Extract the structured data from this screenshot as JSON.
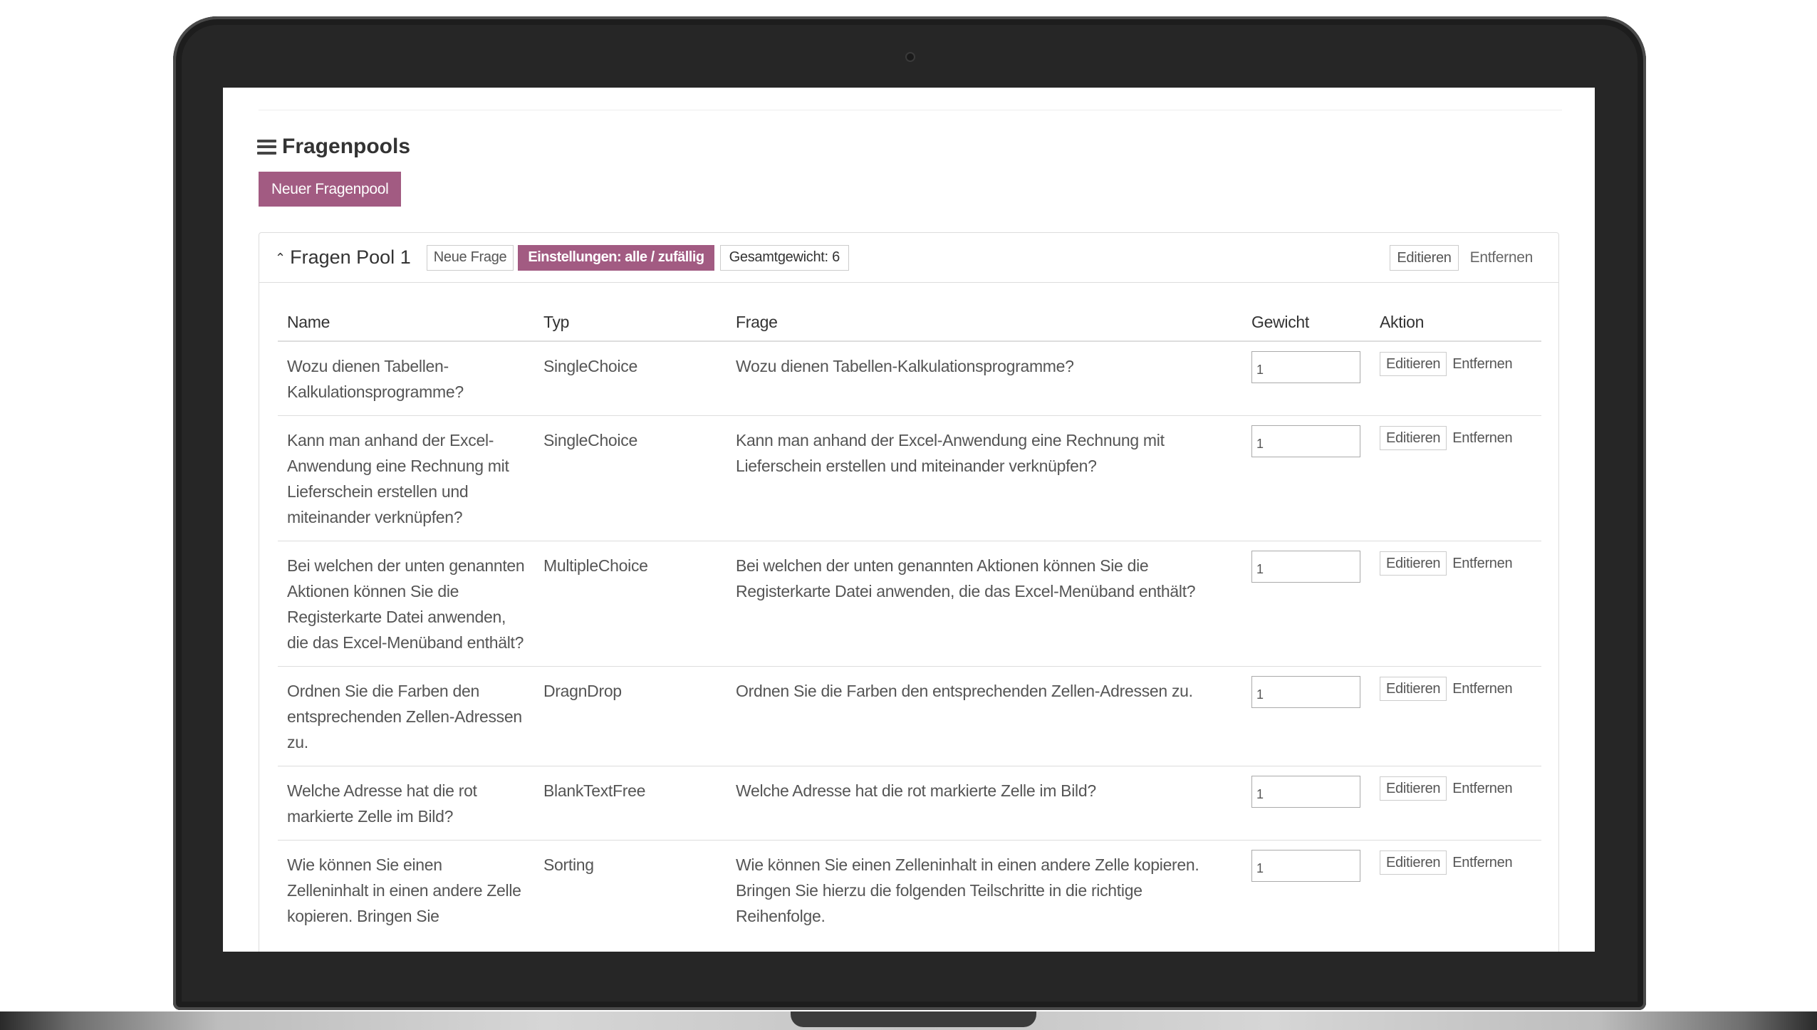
{
  "page": {
    "title": "Fragenpools",
    "new_pool_label": "Neuer Fragenpool"
  },
  "pool": {
    "title": "Fragen Pool",
    "number": "1",
    "new_question_label": "Neue Frage",
    "settings_label": "Einstellungen: alle  /  zufällig",
    "total_weight_label": "Gesamtgewicht: 6",
    "edit_label": "Editieren",
    "remove_label": "Entfernen"
  },
  "table": {
    "headers": {
      "name": "Name",
      "type": "Typ",
      "question": "Frage",
      "weight": "Gewicht",
      "action": "Aktion"
    },
    "rows": [
      {
        "name": "Wozu dienen Tabellen-Kalkulationsprogramme?",
        "type": "SingleChoice",
        "question": "Wozu dienen Tabellen-Kalkulationsprogramme?",
        "weight": "1",
        "edit": "Editieren",
        "remove": "Entfernen"
      },
      {
        "name": "Kann man anhand der Excel-Anwendung eine Rechnung mit Lieferschein erstellen und miteinander verknüpfen?",
        "type": "SingleChoice",
        "question": "Kann man anhand der Excel-Anwendung eine Rechnung mit Lieferschein erstellen und miteinander verknüpfen?",
        "weight": "1",
        "edit": "Editieren",
        "remove": "Entfernen"
      },
      {
        "name": "Bei welchen der unten genannten Aktionen können Sie die Registerkarte Datei anwenden, die das Excel-Menüband enthält?",
        "type": "MultipleChoice",
        "question": "Bei welchen der unten genannten Aktionen können Sie die Registerkarte Datei anwenden, die das Excel-Menüband enthält?",
        "weight": "1",
        "edit": "Editieren",
        "remove": "Entfernen"
      },
      {
        "name": "Ordnen Sie die Farben den entsprechenden Zellen-Adressen zu.",
        "type": "DragnDrop",
        "question": "Ordnen Sie die Farben den entsprechenden Zellen-Adressen zu.",
        "weight": "1",
        "edit": "Editieren",
        "remove": "Entfernen"
      },
      {
        "name": "Welche Adresse hat die rot markierte Zelle im Bild?",
        "type": "BlankTextFree",
        "question": "Welche Adresse hat die rot markierte Zelle im Bild?",
        "weight": "1",
        "edit": "Editieren",
        "remove": "Entfernen"
      },
      {
        "name": "Wie können Sie einen Zelleninhalt in einen andere Zelle kopieren. Bringen Sie",
        "type": "Sorting",
        "question": "Wie können Sie einen Zelleninhalt in einen andere Zelle kopieren. Bringen Sie hierzu die folgenden Teilschritte in die richtige Reihenfolge.",
        "weight": "1",
        "edit": "Editieren",
        "remove": "Entfernen"
      }
    ]
  },
  "colors": {
    "accent": "#a25b82",
    "laptop_frame": "#262626"
  }
}
